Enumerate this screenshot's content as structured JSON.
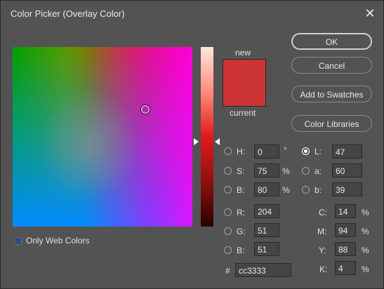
{
  "title": "Color Picker (Overlay Color)",
  "close_glyph": "✕",
  "swatch": {
    "new_label": "new",
    "current_label": "current",
    "new_color": "#cc3333",
    "current_color": "#cc3333"
  },
  "buttons": {
    "ok": "OK",
    "cancel": "Cancel",
    "add_to_swatches": "Add to Swatches",
    "color_libraries": "Color Libraries"
  },
  "fields": {
    "h": {
      "label": "H:",
      "value": "0",
      "unit": "°"
    },
    "s": {
      "label": "S:",
      "value": "75",
      "unit": "%"
    },
    "b_hsb": {
      "label": "B:",
      "value": "80",
      "unit": "%"
    },
    "r": {
      "label": "R:",
      "value": "204"
    },
    "g": {
      "label": "G:",
      "value": "51"
    },
    "b_rgb": {
      "label": "B:",
      "value": "51"
    },
    "l": {
      "label": "L:",
      "value": "47"
    },
    "a": {
      "label": "a:",
      "value": "60"
    },
    "b_lab": {
      "label": "b:",
      "value": "39"
    },
    "c": {
      "label": "C:",
      "value": "14",
      "unit": "%"
    },
    "m": {
      "label": "M:",
      "value": "94",
      "unit": "%"
    },
    "y": {
      "label": "Y:",
      "value": "88",
      "unit": "%"
    },
    "k": {
      "label": "K:",
      "value": "4",
      "unit": "%"
    }
  },
  "hex": {
    "label": "#",
    "value": "cc3333"
  },
  "only_web_colors": {
    "label": "Only Web Colors",
    "checked": false
  },
  "selected_mode": "L"
}
